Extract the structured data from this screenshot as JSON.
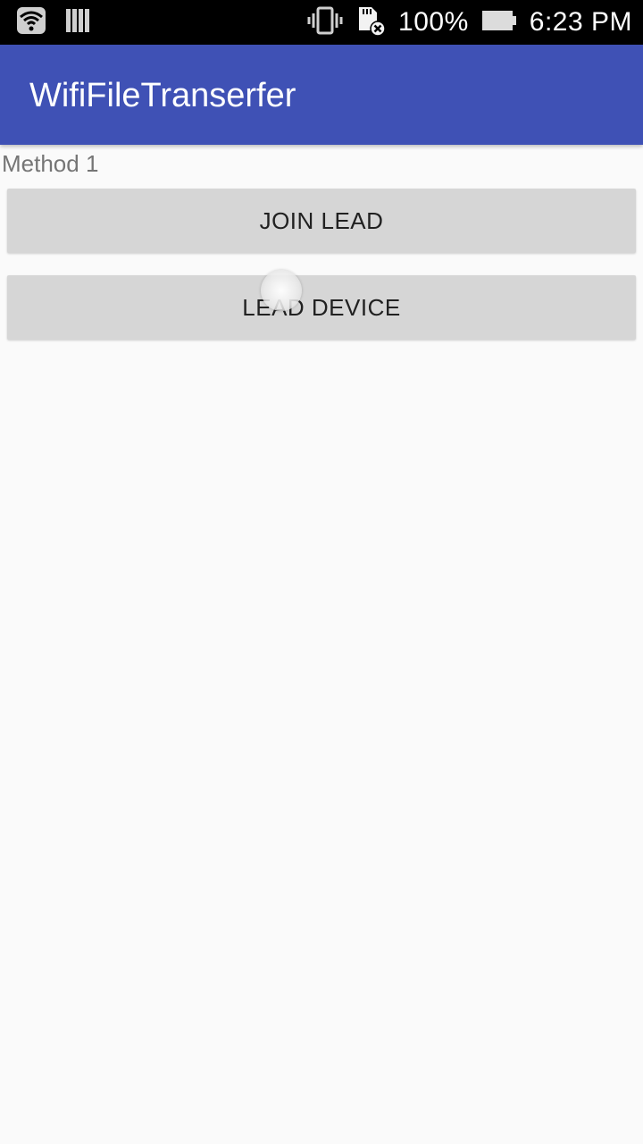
{
  "status_bar": {
    "battery_percent": "100%",
    "time": "6:23 PM",
    "icons": [
      "wifi-icon",
      "signal-bars-icon",
      "vibrate-icon",
      "sd-card-error-icon",
      "battery-icon"
    ]
  },
  "app_bar": {
    "title": "WifiFileTranserfer",
    "color": "#3f51b5"
  },
  "main": {
    "section_label": "Method 1",
    "buttons": [
      {
        "label": "JOIN LEAD"
      },
      {
        "label": "LEAD DEVICE"
      }
    ]
  }
}
